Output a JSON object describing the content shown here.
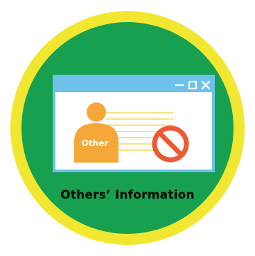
{
  "badge": {
    "caption": "Others’ Information",
    "person_label": "Other"
  },
  "window": {
    "controls": [
      "minimize-icon",
      "maximize-icon",
      "close-icon"
    ]
  },
  "icons": {
    "person": "person-icon",
    "prohibited": "prohibited-icon"
  },
  "colors": {
    "outer_ring": "#f1e730",
    "disc": "#16a04f",
    "window_frame": "#6ec1ea",
    "person": "#f6a73a",
    "text_lines": "#f2da5c",
    "prohibited": "#ec5a33"
  }
}
